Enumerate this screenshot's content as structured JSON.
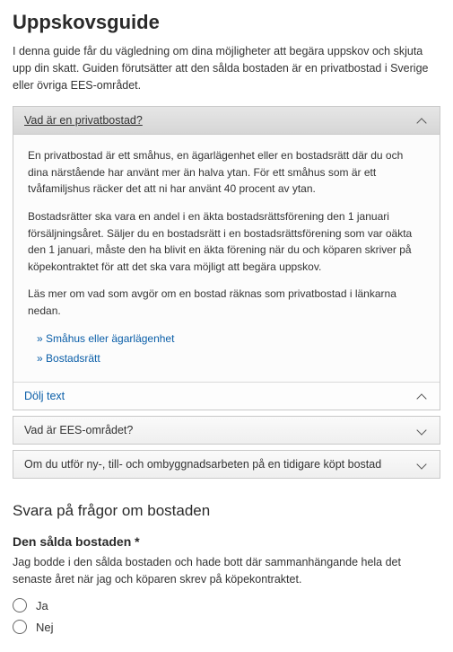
{
  "title": "Uppskovsguide",
  "intro": "I denna guide får du vägledning om dina möjligheter att begära uppskov och skjuta upp din skatt. Guiden förutsätter att den sålda bostaden är en privatbostad i Sverige eller övriga EES-området.",
  "acc1": {
    "title": "Vad är en privatbostad?",
    "p1": "En privatbostad är ett småhus, en ägarlägenhet eller en bostadsrätt där du och dina närstående har använt mer än halva ytan. För ett småhus som är ett tvåfamiljshus räcker det att ni har använt 40 procent av ytan.",
    "p2": "Bostadsrätter ska vara en andel i en äkta bostadsrättsförening den 1 januari försäljningsåret. Säljer du en bostadsrätt i en bostadsrättsförening som var oäkta den 1 januari, måste den ha blivit en äkta förening när du och köparen skriver på köpekontraktet för att det ska vara möjligt att begära uppskov.",
    "p3": "Läs mer om vad som avgör om en bostad räknas som privatbostad i länkarna nedan.",
    "link1": "Småhus eller ägarlägenhet",
    "link2": "Bostadsrätt",
    "hide": "Dölj text"
  },
  "acc2": {
    "title": "Vad är EES-området?"
  },
  "acc3": {
    "title": "Om du utför ny-, till- och ombyggnadsarbeten på en tidigare köpt bostad"
  },
  "section2": "Svara på frågor om bostaden",
  "q1": {
    "label": "Den sålda bostaden *",
    "text": "Jag bodde i den sålda bostaden och hade bott där sammanhängande hela det senaste året när jag och köparen skrev på köpekontraktet.",
    "opt1": "Ja",
    "opt2": "Nej"
  }
}
